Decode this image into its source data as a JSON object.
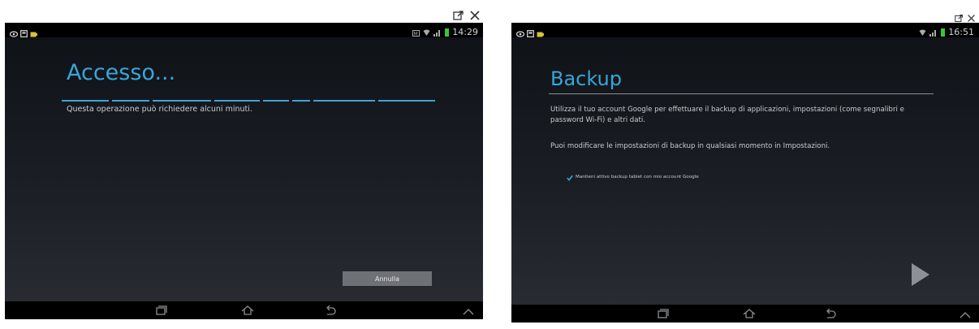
{
  "left": {
    "clock": "14:29",
    "title": "Accesso...",
    "subtitle": "Questa operazione può richiedere alcuni minuti.",
    "cancel_button": "Annulla"
  },
  "right": {
    "clock": "16:51",
    "title": "Backup",
    "paragraph1": "Utilizza il tuo account Google per effettuare il backup di applicazioni, impostazioni (come segnalibri e password Wi-Fi) e altri dati.",
    "paragraph2": "Puoi modificare le impostazioni di backup in qualsiasi momento in Impostazioni.",
    "checkbox_label": "Mantieni attivo backup tablet con mio account Google",
    "checkbox_checked": true
  },
  "colors": {
    "accent": "#39a6d8",
    "button": "#6e7176"
  }
}
